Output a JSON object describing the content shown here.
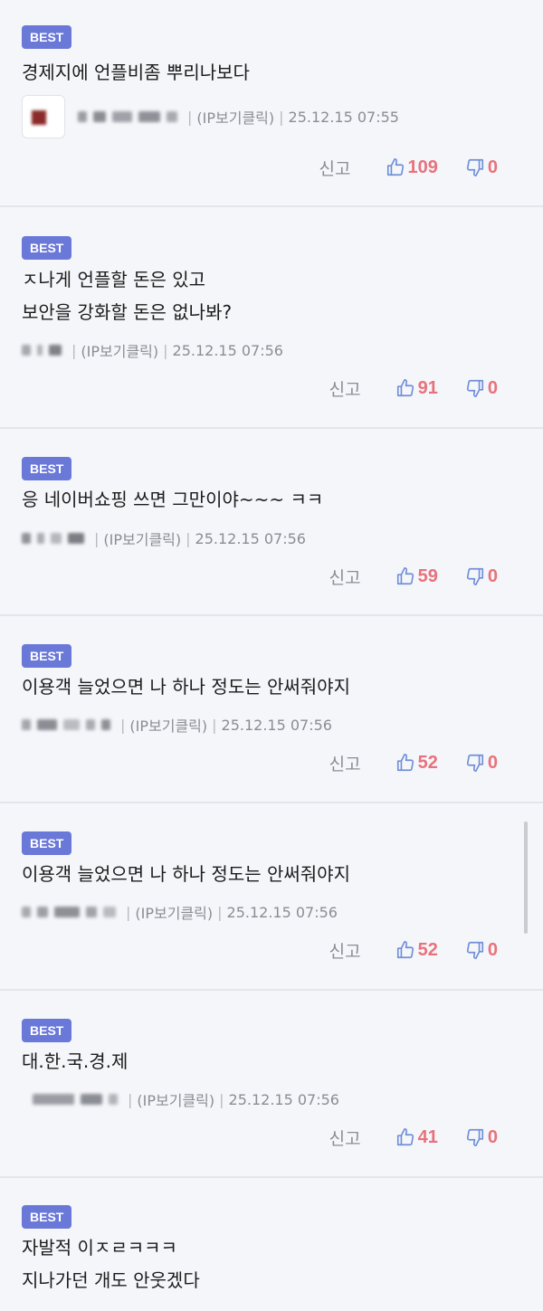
{
  "badge_label": "BEST",
  "report_label": "신고",
  "colors": {
    "badge": "#6a78d8",
    "count": "#e8727c",
    "meta": "#8a8d94"
  },
  "comments": [
    {
      "lines": [
        "경제지에 언플비좀 뿌리나보다"
      ],
      "ip": "(IP보기클릭)",
      "date": "25.12.15 07:55",
      "likes": "109",
      "dislikes": "0"
    },
    {
      "lines": [
        "ㅈ나게 언플할 돈은 있고",
        "보안을 강화할 돈은 없나봐?"
      ],
      "ip": "(IP보기클릭)",
      "date": "25.12.15 07:56",
      "likes": "91",
      "dislikes": "0"
    },
    {
      "lines": [
        "응 네이버쇼핑 쓰면 그만이야~~~ ㅋㅋ"
      ],
      "ip": "(IP보기클릭)",
      "date": "25.12.15 07:56",
      "likes": "59",
      "dislikes": "0"
    },
    {
      "lines": [
        "이용객 늘었으면 나 하나 정도는 안써줘야지"
      ],
      "ip": "(IP보기클릭)",
      "date": "25.12.15 07:56",
      "likes": "52",
      "dislikes": "0"
    },
    {
      "lines": [
        "이용객 늘었으면 나 하나 정도는 안써줘야지"
      ],
      "ip": "(IP보기클릭)",
      "date": "25.12.15 07:56",
      "likes": "52",
      "dislikes": "0"
    },
    {
      "lines": [
        "대.한.국.경.제"
      ],
      "ip": "(IP보기클릭)",
      "date": "25.12.15 07:56",
      "likes": "41",
      "dislikes": "0"
    },
    {
      "lines": [
        "자발적 이ㅈㄹㅋㅋㅋ",
        "지나가던 개도 안웃겠다"
      ]
    }
  ]
}
